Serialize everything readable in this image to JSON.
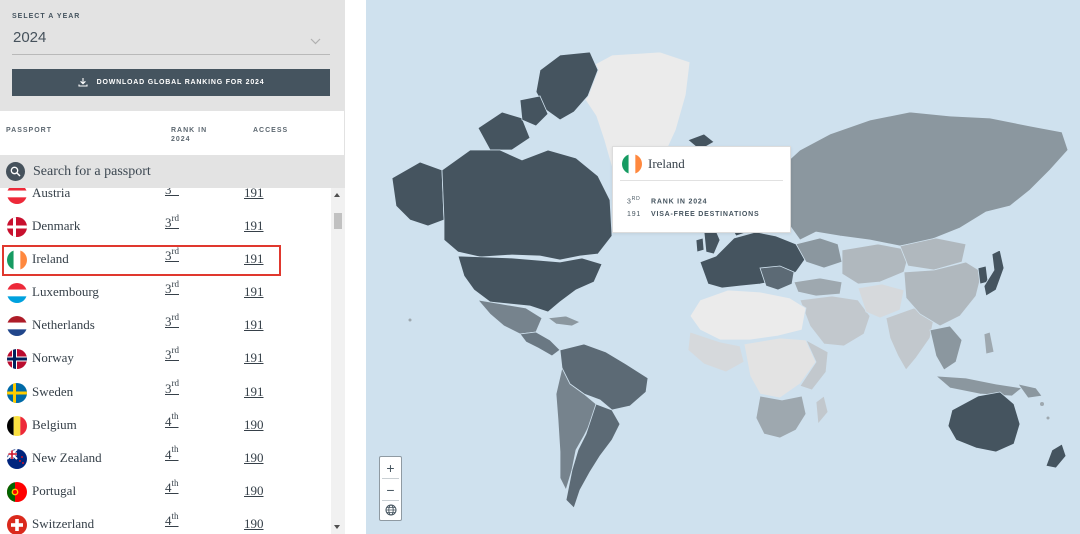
{
  "year_selector": {
    "label": "SELECT A YEAR",
    "value": "2024"
  },
  "download_button": {
    "label": "DOWNLOAD GLOBAL RANKING FOR 2024"
  },
  "columns": {
    "passport": "PASSPORT",
    "rank_line1": "RANK IN",
    "rank_line2": "2024",
    "access": "ACCESS"
  },
  "search": {
    "placeholder": "Search for a passport"
  },
  "countries": [
    {
      "name": "Austria",
      "rank_num": "3",
      "rank_suffix": "rd",
      "access": "191",
      "flag": "austria"
    },
    {
      "name": "Denmark",
      "rank_num": "3",
      "rank_suffix": "rd",
      "access": "191",
      "flag": "denmark"
    },
    {
      "name": "Ireland",
      "rank_num": "3",
      "rank_suffix": "rd",
      "access": "191",
      "flag": "ireland",
      "selected": true
    },
    {
      "name": "Luxembourg",
      "rank_num": "3",
      "rank_suffix": "rd",
      "access": "191",
      "flag": "luxembourg"
    },
    {
      "name": "Netherlands",
      "rank_num": "3",
      "rank_suffix": "rd",
      "access": "191",
      "flag": "netherlands"
    },
    {
      "name": "Norway",
      "rank_num": "3",
      "rank_suffix": "rd",
      "access": "191",
      "flag": "norway"
    },
    {
      "name": "Sweden",
      "rank_num": "3",
      "rank_suffix": "rd",
      "access": "191",
      "flag": "sweden"
    },
    {
      "name": "Belgium",
      "rank_num": "4",
      "rank_suffix": "th",
      "access": "190",
      "flag": "belgium"
    },
    {
      "name": "New Zealand",
      "rank_num": "4",
      "rank_suffix": "th",
      "access": "190",
      "flag": "new-zealand"
    },
    {
      "name": "Portugal",
      "rank_num": "4",
      "rank_suffix": "th",
      "access": "190",
      "flag": "portugal"
    },
    {
      "name": "Switzerland",
      "rank_num": "4",
      "rank_suffix": "th",
      "access": "190",
      "flag": "switzerland"
    }
  ],
  "tooltip": {
    "country": "Ireland",
    "rank_num": "3",
    "rank_suffix": "RD",
    "rank_label": "RANK IN 2024",
    "access_num": "191",
    "access_label": "VISA-FREE DESTINATIONS"
  },
  "map_controls": {
    "zoom_in": "+",
    "zoom_out": "−"
  },
  "colors": {
    "sea": "#cfe1ee",
    "dark": "#45545f",
    "selected_border": "#e0382e"
  }
}
